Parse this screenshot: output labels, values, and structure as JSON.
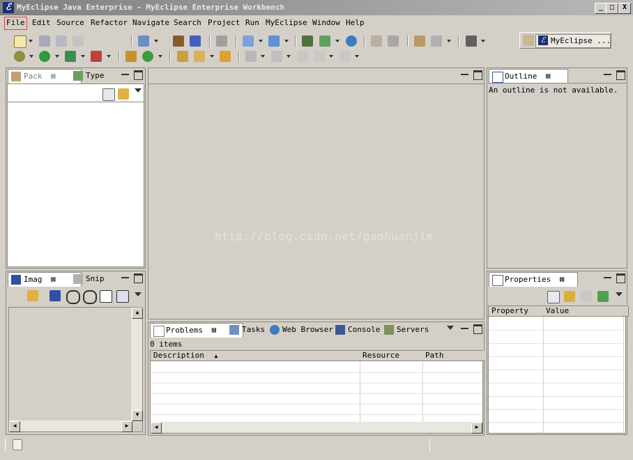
{
  "window": {
    "title": "MyEclipse Java Enterprise - MyEclipse Enterprise Workbench",
    "buttons": [
      "_",
      "□",
      "X"
    ]
  },
  "menu": [
    "File",
    "Edit",
    "Source",
    "Refactor",
    "Navigate",
    "Search",
    "Project",
    "Run",
    "MyEclipse",
    "Window",
    "Help"
  ],
  "perspective": {
    "label": "MyEclipse ..."
  },
  "left_top_view": {
    "tabs": [
      {
        "label": "Pack",
        "active": true
      },
      {
        "label": "Type",
        "active": false
      }
    ]
  },
  "left_bottom_view": {
    "tabs": [
      {
        "label": "Imag",
        "active": true
      },
      {
        "label": "Snip",
        "active": false
      }
    ]
  },
  "outline_view": {
    "tab": "Outline",
    "message": "An outline is not available."
  },
  "properties_view": {
    "tab": "Properties",
    "columns": [
      "Property",
      "Value"
    ]
  },
  "bottom_view": {
    "tabs": [
      {
        "label": "Problems",
        "active": true
      },
      {
        "label": "Tasks",
        "active": false
      },
      {
        "label": "Web Browser",
        "active": false
      },
      {
        "label": "Console",
        "active": false
      },
      {
        "label": "Servers",
        "active": false
      }
    ],
    "count": "0 items",
    "columns": [
      "Description",
      "Resource",
      "Path"
    ]
  },
  "watermark": "http://blog.csdn.net/gaohuanjie",
  "colors": {
    "chrome": "#d4d0c8",
    "title_start": "#808080",
    "title_end": "#b8b8b8",
    "highlight": "#e04040"
  }
}
